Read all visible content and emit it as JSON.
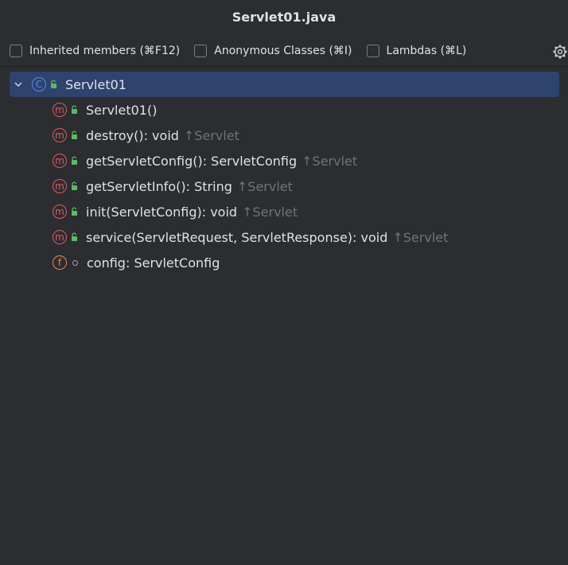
{
  "window": {
    "title": "Servlet01.java"
  },
  "options": [
    {
      "label": "Inherited members (⌘F12)",
      "checked": false
    },
    {
      "label": "Anonymous Classes (⌘I)",
      "checked": false
    },
    {
      "label": "Lambdas (⌘L)",
      "checked": false
    }
  ],
  "settings_icon": "gear-icon",
  "tree": {
    "root": {
      "kind_icon": "C",
      "name": "Servlet01",
      "expanded": true
    },
    "members": [
      {
        "kind_icon": "m",
        "visibility": "public",
        "signature": "Servlet01()",
        "inherited": ""
      },
      {
        "kind_icon": "m",
        "visibility": "public",
        "signature": "destroy(): void",
        "inherited": "↑Servlet"
      },
      {
        "kind_icon": "m",
        "visibility": "public",
        "signature": "getServletConfig(): ServletConfig",
        "inherited": "↑Servlet"
      },
      {
        "kind_icon": "m",
        "visibility": "public",
        "signature": "getServletInfo(): String",
        "inherited": "↑Servlet"
      },
      {
        "kind_icon": "m",
        "visibility": "public",
        "signature": "init(ServletConfig): void",
        "inherited": "↑Servlet"
      },
      {
        "kind_icon": "m",
        "visibility": "public",
        "signature": "service(ServletRequest, ServletResponse): void",
        "inherited": "↑Servlet"
      },
      {
        "kind_icon": "f",
        "visibility": "package-private",
        "signature": "config: ServletConfig",
        "inherited": ""
      }
    ]
  },
  "colors": {
    "background": "#2b2d30",
    "selection": "#2e436e",
    "text": "#dfe1e5",
    "inherited_text": "#6f737a",
    "class_icon": "#548af7",
    "method_icon": "#e55765",
    "field_icon": "#e08855",
    "public_lock": "#5fb865"
  }
}
